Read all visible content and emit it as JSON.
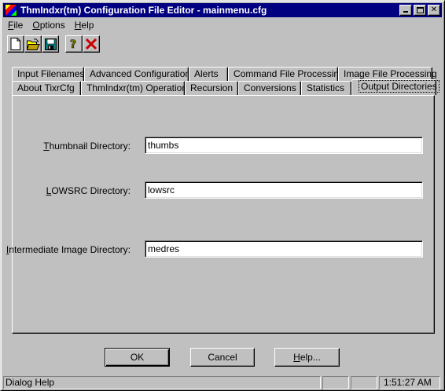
{
  "window": {
    "title": "ThmIndxr(tm) Configuration File Editor - mainmenu.cfg"
  },
  "menu": [
    {
      "label": "File",
      "mnemonic": "F",
      "rest": "ile"
    },
    {
      "label": "Options",
      "mnemonic": "O",
      "rest": "ptions"
    },
    {
      "label": "Help",
      "mnemonic": "H",
      "rest": "elp"
    }
  ],
  "toolbar": {
    "buttons": [
      "new-file-icon",
      "open-folder-icon",
      "save-disk-icon",
      "help-icon",
      "delete-x-icon"
    ]
  },
  "tabs": {
    "back_row": [
      "Input Filenames",
      "Advanced Configuration",
      "Alerts",
      "Command File Processing",
      "Image File Processing"
    ],
    "front_row": [
      "About TixrCfg",
      "ThmIndxr(tm) Operation",
      "Recursion",
      "Conversions",
      "Statistics",
      "Output Directories"
    ],
    "active": "Output Directories"
  },
  "fields": {
    "thumbnail": {
      "label_mn": "T",
      "label_rest": "humbnail Directory:",
      "value": "thumbs"
    },
    "lowsrc": {
      "label_pre": "",
      "label_mn": "L",
      "label_rest": "OWSRC Directory:",
      "value": "lowsrc"
    },
    "intermediate": {
      "label_mn": "I",
      "label_rest": "ntermediate Image Directory:",
      "value": "medres"
    }
  },
  "buttons": {
    "ok": "OK",
    "cancel": "Cancel",
    "help_mn": "H",
    "help_rest": "elp..."
  },
  "status": {
    "message": "Dialog Help",
    "time": "1:51:27 AM"
  }
}
